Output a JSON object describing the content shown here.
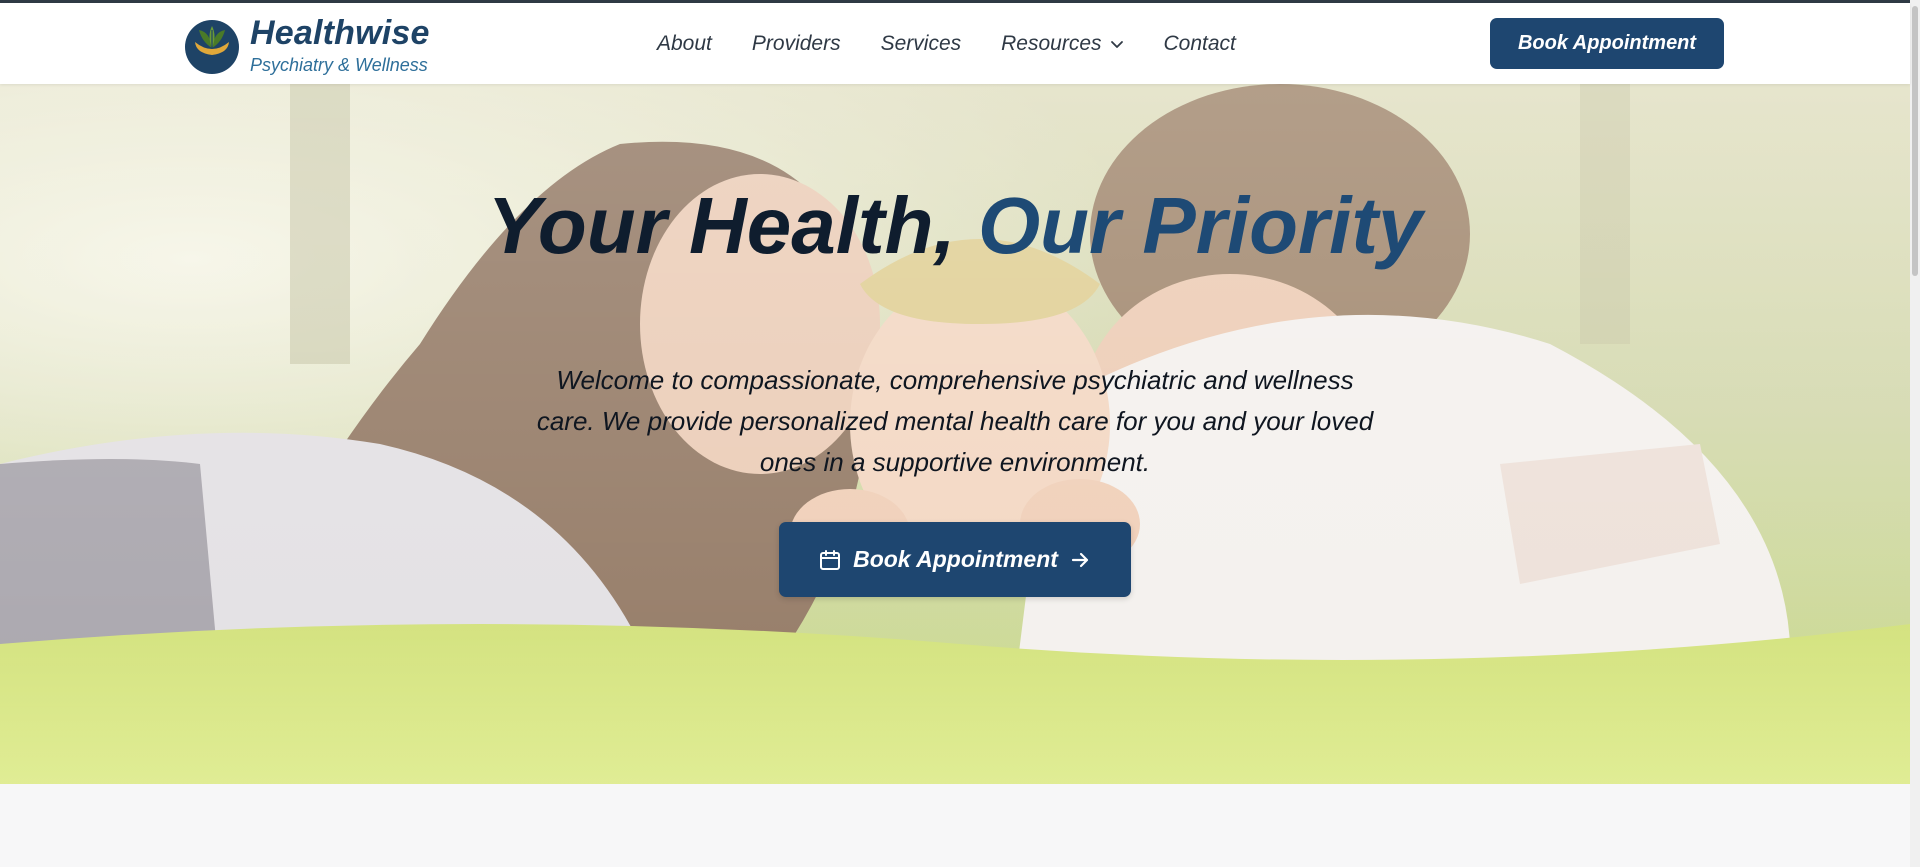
{
  "brand": {
    "name": "Healthwise",
    "tagline": "Psychiatry & Wellness",
    "colors": {
      "primary": "#1e4670",
      "accent": "#1e4a75",
      "leaf": "#4a7a28",
      "bowl": "#e0a83a"
    }
  },
  "nav": {
    "items": [
      {
        "label": "About"
      },
      {
        "label": "Providers"
      },
      {
        "label": "Services"
      },
      {
        "label": "Resources",
        "icon": "chevron-down-icon"
      },
      {
        "label": "Contact"
      }
    ],
    "cta_label": "Book Appointment"
  },
  "hero": {
    "title_main": "Your Health,",
    "title_accent": "Our Priority",
    "subtitle": "Welcome to compassionate, comprehensive psychiatric and wellness care. We provide personalized mental health care for you and your loved ones in a supportive environment.",
    "cta_label": "Book Appointment",
    "cta_icon_left": "calendar-icon",
    "cta_icon_right": "arrow-right-icon",
    "image": "family-on-grass-photo"
  }
}
